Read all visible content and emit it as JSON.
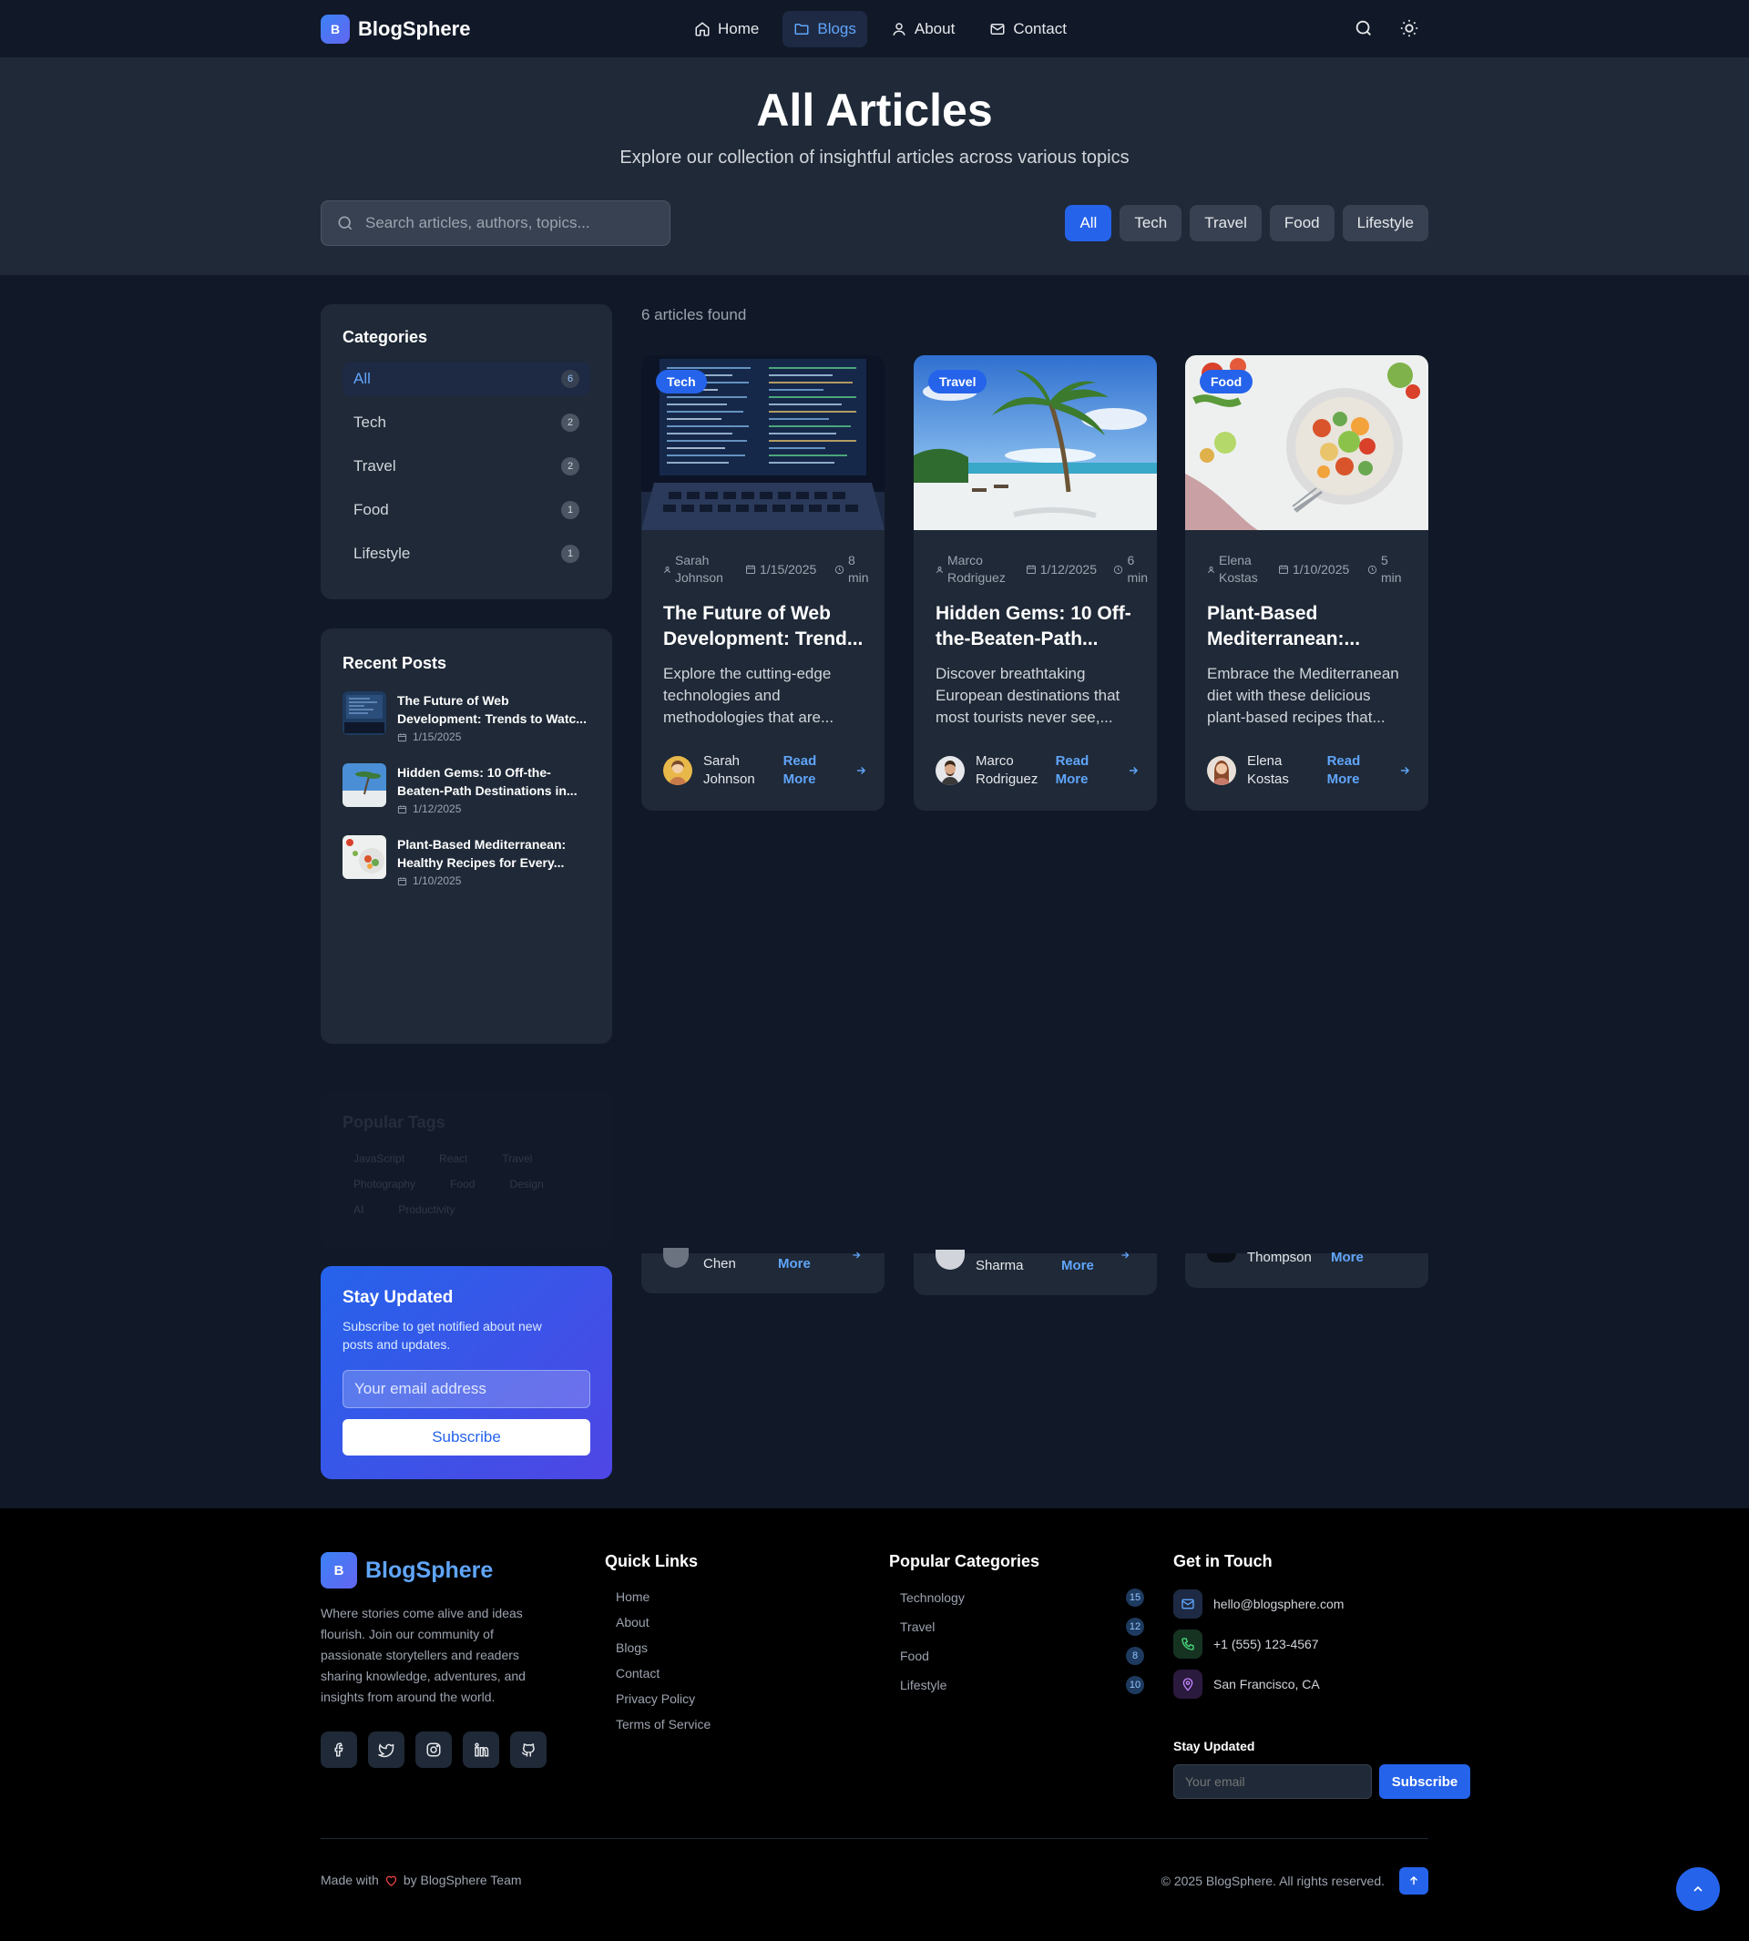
{
  "nav": {
    "logo_letter": "B",
    "brand": "BlogSphere",
    "links": [
      {
        "label": "Home",
        "icon": "home-icon"
      },
      {
        "label": "Blogs",
        "icon": "folder-icon",
        "active": true
      },
      {
        "label": "About",
        "icon": "user-icon"
      },
      {
        "label": "Contact",
        "icon": "mail-icon"
      }
    ]
  },
  "hero": {
    "title": "All Articles",
    "subtitle": "Explore our collection of insightful articles across various topics",
    "search_placeholder": "Search articles, authors, topics...",
    "filters": [
      "All",
      "Tech",
      "Travel",
      "Food",
      "Lifestyle"
    ],
    "active_filter": "All"
  },
  "sidebar": {
    "categories_title": "Categories",
    "categories": [
      {
        "name": "All",
        "count": "6"
      },
      {
        "name": "Tech",
        "count": "2"
      },
      {
        "name": "Travel",
        "count": "2"
      },
      {
        "name": "Food",
        "count": "1"
      },
      {
        "name": "Lifestyle",
        "count": "1"
      }
    ],
    "recent_title": "Recent Posts",
    "recent": [
      {
        "title": "The Future of Web Development: Trends to Watc...",
        "date": "1/15/2025"
      },
      {
        "title": "Hidden Gems: 10 Off-the-Beaten-Path Destinations in...",
        "date": "1/12/2025"
      },
      {
        "title": "Plant-Based Mediterranean: Healthy Recipes for Every...",
        "date": "1/10/2025"
      }
    ],
    "tags_title": "Popular Tags",
    "tags": [
      "JavaScript",
      "React",
      "Travel",
      "Photography",
      "Food",
      "Design",
      "AI",
      "Productivity"
    ]
  },
  "main": {
    "count_text": "6 articles found",
    "articles": [
      {
        "tag": "Tech",
        "author_first": "Sarah",
        "author_last": "Johnson",
        "date": "1/15/2025",
        "read_num": "8",
        "read_unit": "min",
        "title": "The Future of Web Development: Trend...",
        "desc": "Explore the cutting-edge technologies and methodologies that are...",
        "author": "Sarah Johnson",
        "read_more": "Read More"
      },
      {
        "tag": "Travel",
        "author_first": "Marco",
        "author_last": "Rodriguez",
        "date": "1/12/2025",
        "read_num": "6",
        "read_unit": "min",
        "title": "Hidden Gems: 10 Off-the-Beaten-Path...",
        "desc": "Discover breathtaking European destinations that most tourists never see,...",
        "author": "Marco Rodriguez",
        "read_more": "Read More"
      },
      {
        "tag": "Food",
        "author_first": "Elena",
        "author_last": "Kostas",
        "date": "1/10/2025",
        "read_num": "5",
        "read_unit": "min",
        "title": "Plant-Based Mediterranean:...",
        "desc": "Embrace the Mediterranean diet with these delicious plant-based recipes that...",
        "author": "Elena Kostas",
        "read_more": "Read More"
      }
    ],
    "ghost_rows": [
      {
        "name": "Chen",
        "more": "More"
      },
      {
        "name": "Sharma",
        "more": "More"
      },
      {
        "name": "Thompson",
        "more": "More"
      }
    ]
  },
  "newsletter": {
    "title": "Stay Updated",
    "text": "Subscribe to get notified about new posts and updates.",
    "placeholder": "Your email address",
    "button": "Subscribe"
  },
  "footer": {
    "brand": "BlogSphere",
    "logo_letter": "B",
    "about": "Where stories come alive and ideas flourish. Join our community of passionate storytellers and readers sharing knowledge, adventures, and insights from around the world.",
    "quick_title": "Quick Links",
    "quick_links": [
      "Home",
      "About",
      "Blogs",
      "Contact",
      "Privacy Policy",
      "Terms of Service"
    ],
    "cat_title": "Popular Categories",
    "categories": [
      {
        "name": "Technology",
        "count": "15"
      },
      {
        "name": "Travel",
        "count": "12"
      },
      {
        "name": "Food",
        "count": "8"
      },
      {
        "name": "Lifestyle",
        "count": "10"
      }
    ],
    "contact_title": "Get in Touch",
    "email": "hello@blogsphere.com",
    "phone": "+1 (555) 123-4567",
    "location": "San Francisco, CA",
    "stay_title": "Stay Updated",
    "stay_placeholder": "Your email",
    "stay_button": "Subscribe",
    "made_with_1": "Made with",
    "made_with_2": "by BlogSphere Team",
    "copyright": "© 2025 BlogSphere. All rights reserved."
  },
  "colors": {
    "accent": "#2563eb",
    "link": "#60a5fa",
    "bg": "#111827",
    "panel": "#1f2937"
  }
}
